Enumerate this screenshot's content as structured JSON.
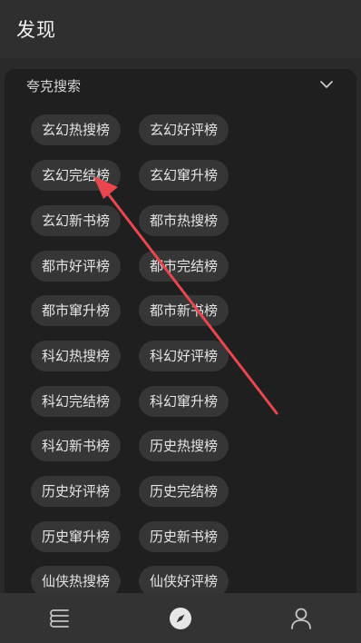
{
  "header": {
    "title": "发现"
  },
  "section": {
    "title": "夸克搜索",
    "icon": "chevron-down-icon"
  },
  "tags": [
    "玄幻热搜榜",
    "玄幻好评榜",
    "玄幻完结榜",
    "玄幻窜升榜",
    "玄幻新书榜",
    "都市热搜榜",
    "都市好评榜",
    "都市完结榜",
    "都市窜升榜",
    "都市新书榜",
    "科幻热搜榜",
    "科幻好评榜",
    "科幻完结榜",
    "科幻窜升榜",
    "科幻新书榜",
    "历史热搜榜",
    "历史好评榜",
    "历史完结榜",
    "历史窜升榜",
    "历史新书榜",
    "仙侠热搜榜",
    "仙侠好评榜"
  ],
  "nav": [
    {
      "name": "bookshelf",
      "icon": "bookshelf-icon",
      "active": false
    },
    {
      "name": "discover",
      "icon": "compass-icon",
      "active": true
    },
    {
      "name": "profile",
      "icon": "person-icon",
      "active": false
    }
  ],
  "colors": {
    "background": "#2a2a2a",
    "card": "#1f1f1f",
    "tag": "#363636",
    "annotation_arrow": "#e8474f"
  }
}
